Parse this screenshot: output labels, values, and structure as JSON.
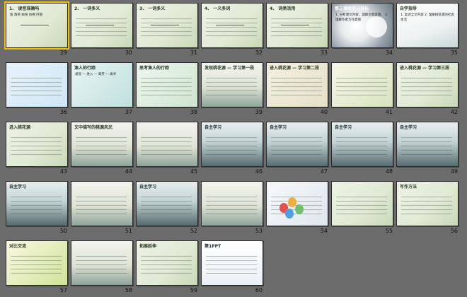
{
  "slides": [
    {
      "num": "29",
      "title": "1、 读音准确吗",
      "body": "渔 落英 缤纷 仿佛 阡陌",
      "theme": "paper"
    },
    {
      "num": "30",
      "title": "2、 一词多义",
      "body": "",
      "theme": "paper"
    },
    {
      "num": "31",
      "title": "3、 一词多义",
      "body": "",
      "theme": "paper"
    },
    {
      "num": "32",
      "title": "4、 一义多词",
      "body": "",
      "theme": "paper"
    },
    {
      "num": "33",
      "title": "4、 词类活用",
      "body": "",
      "theme": "paper"
    },
    {
      "num": "34",
      "title": "第三课时学习目标",
      "body": "1. 分析课文内容，理解文章思想。 2. 理解作者写作意图",
      "theme": "moon"
    },
    {
      "num": "35",
      "title": "自学指导",
      "body": "1. 复述全文内容 2. 理解桃花源的社会生活",
      "theme": "lotus"
    },
    {
      "num": "36",
      "title": "",
      "body": "",
      "theme": "blue-diagram"
    },
    {
      "num": "37",
      "title": "渔人的行踪",
      "body": "发现 — 进入 — 离开 — 再寻",
      "theme": "teal"
    },
    {
      "num": "38",
      "title": "思考渔人的行踪",
      "body": "",
      "theme": "green"
    },
    {
      "num": "39",
      "title": "发现桃花源 — 学习第一段",
      "body": "",
      "theme": "ink"
    },
    {
      "num": "40",
      "title": "进入桃花源 — 学习第二段",
      "body": "",
      "theme": "paper2"
    },
    {
      "num": "41",
      "title": "",
      "body": "",
      "theme": "bamboo"
    },
    {
      "num": "42",
      "title": "进入桃花源 — 学习第三段",
      "body": "",
      "theme": "paper"
    },
    {
      "num": "43",
      "title": "进入桃花源",
      "body": "",
      "theme": "paper"
    },
    {
      "num": "44",
      "title": "文中描写的桃源风光",
      "body": "",
      "theme": "ink"
    },
    {
      "num": "45",
      "title": "",
      "body": "",
      "theme": "ink"
    },
    {
      "num": "46",
      "title": "自主学习",
      "body": "",
      "theme": "river"
    },
    {
      "num": "47",
      "title": "自主学习",
      "body": "",
      "theme": "river"
    },
    {
      "num": "48",
      "title": "自主学习",
      "body": "",
      "theme": "river"
    },
    {
      "num": "49",
      "title": "自主学习",
      "body": "",
      "theme": "river"
    },
    {
      "num": "50",
      "title": "自主学习",
      "body": "",
      "theme": "river"
    },
    {
      "num": "51",
      "title": "",
      "body": "",
      "theme": "ink"
    },
    {
      "num": "52",
      "title": "自主学习",
      "body": "",
      "theme": "river"
    },
    {
      "num": "53",
      "title": "",
      "body": "",
      "theme": "ink"
    },
    {
      "num": "54",
      "title": "",
      "body": "",
      "theme": "balloons"
    },
    {
      "num": "55",
      "title": "",
      "body": "",
      "theme": "paper"
    },
    {
      "num": "56",
      "title": "写作方法",
      "body": "",
      "theme": "paper"
    },
    {
      "num": "57",
      "title": "对比交流",
      "body": "",
      "theme": "forest"
    },
    {
      "num": "58",
      "title": "",
      "body": "",
      "theme": "ink"
    },
    {
      "num": "59",
      "title": "拓展延伸",
      "body": "",
      "theme": "paper"
    },
    {
      "num": "60",
      "title": "第1PPT",
      "body": "",
      "theme": "logo"
    }
  ]
}
